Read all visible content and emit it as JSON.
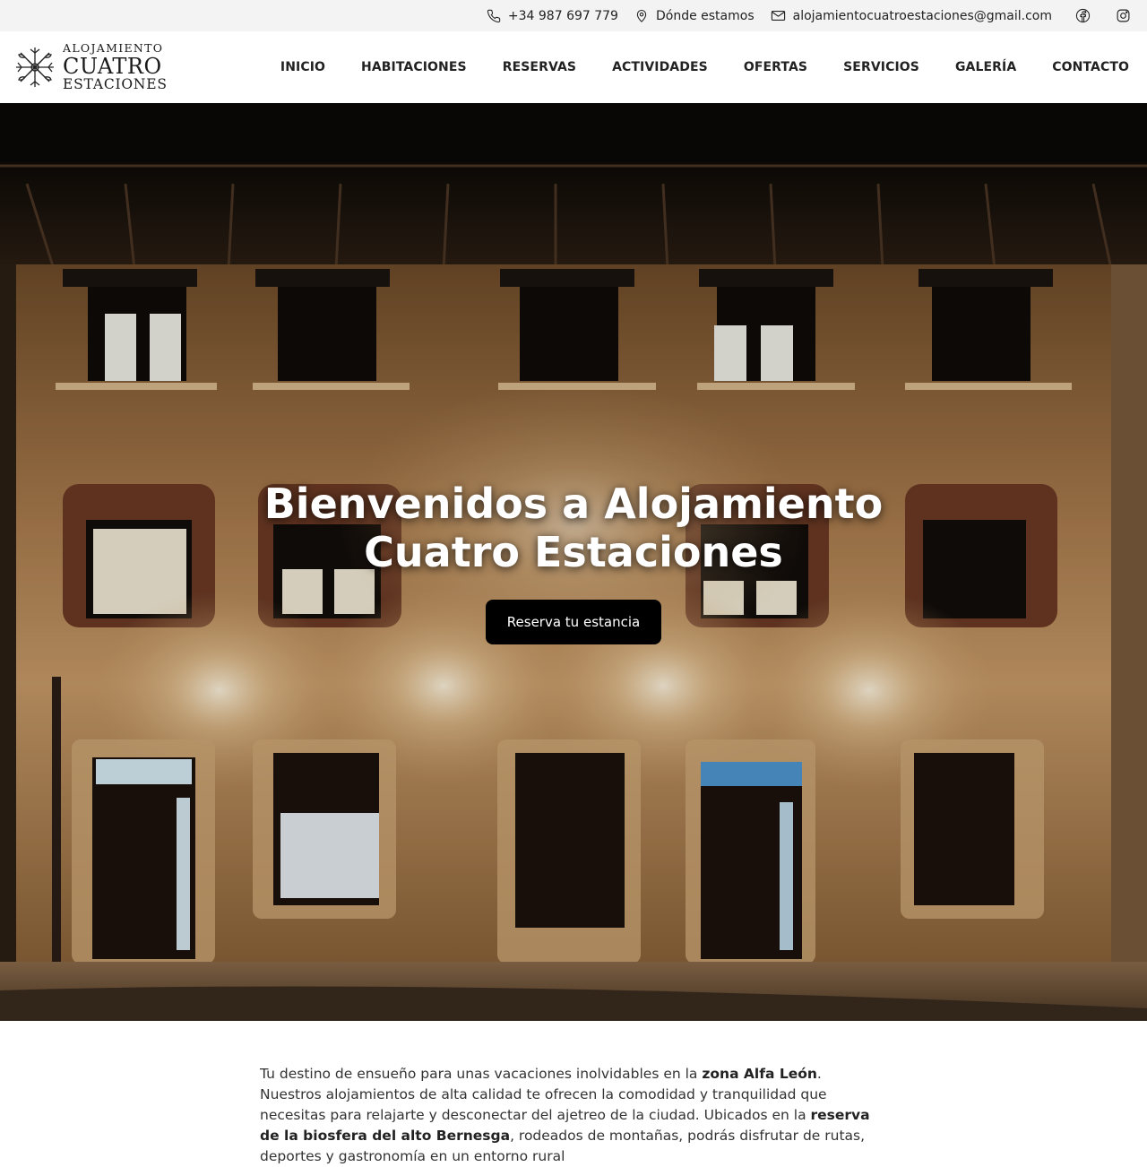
{
  "topbar": {
    "phone": "+34 987 697 779",
    "location": "Dónde estamos",
    "email": "alojamientocuatroestaciones@gmail.com",
    "social": [
      "facebook-icon",
      "instagram-icon"
    ]
  },
  "logo": {
    "line1": "ALOJAMIENTO",
    "line2": "CUATRO",
    "line3": "ESTACIONES"
  },
  "nav": {
    "items": [
      "INICIO",
      "HABITACIONES",
      "RESERVAS",
      "ACTIVIDADES",
      "OFERTAS",
      "SERVICIOS",
      "GALERÍA",
      "CONTACTO"
    ]
  },
  "hero": {
    "title": "Bienvenidos a Alojamiento Cuatro Estaciones",
    "cta": "Reserva tu estancia"
  },
  "intro": {
    "p1_a": "Tu destino de ensueño para unas vacaciones inolvidables en la ",
    "p1_b": "zona Alfa León",
    "p1_c": ". Nuestros alojamientos de alta calidad te ofrecen la comodidad y tranquilidad que necesitas para relajarte y desconectar del ajetreo de la ciudad. Ubicados en la ",
    "p1_d": "reserva de la biosfera del alto Bernesga",
    "p1_e": ", rodeados de montañas, podrás disfrutar de rutas, deportes y gastronomía en un entorno rural"
  },
  "colors": {
    "topbar_bg": "#f3f3f3",
    "button_bg": "#000000",
    "facade": "#b8885a"
  }
}
